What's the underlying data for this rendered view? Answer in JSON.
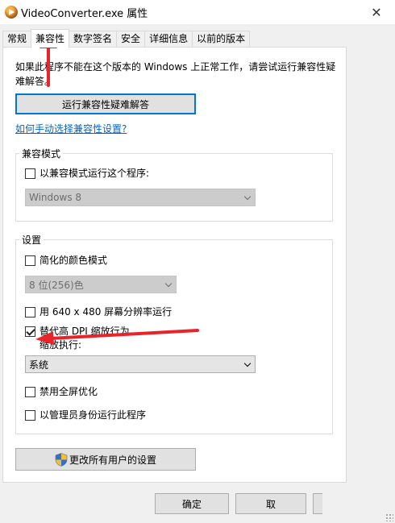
{
  "window": {
    "title": "VideoConverter.exe 属性",
    "close_glyph": "✕"
  },
  "tabs": [
    {
      "label": "常规"
    },
    {
      "label": "兼容性",
      "active": true
    },
    {
      "label": "数字签名"
    },
    {
      "label": "安全"
    },
    {
      "label": "详细信息"
    },
    {
      "label": "以前的版本"
    }
  ],
  "compat": {
    "description": "如果此程序不能在这个版本的 Windows 上正常工作，请尝试运行兼容性疑难解答。",
    "troubleshoot_button": "运行兼容性疑难解答",
    "manual_link": "如何手动选择兼容性设置?"
  },
  "compat_mode": {
    "group_title": "兼容模式",
    "run_in_mode_label": "以兼容模式运行这个程序:",
    "run_in_mode_checked": false,
    "os_select_value": "Windows 8"
  },
  "settings": {
    "group_title": "设置",
    "reduced_color_label": "简化的颜色模式",
    "reduced_color_checked": false,
    "color_select_value": "8 位(256)色",
    "run_640_label": "用 640 x 480 屏幕分辨率运行",
    "run_640_checked": false,
    "dpi_override_label": "替代高 DPI 缩放行为。",
    "dpi_override_sublabel": "缩放执行:",
    "dpi_override_checked": true,
    "dpi_select_value": "系统",
    "disable_fullscreen_label": "禁用全屏优化",
    "disable_fullscreen_checked": false,
    "run_as_admin_label": "以管理员身份运行此程序",
    "run_as_admin_checked": false
  },
  "change_all_users_button": "更改所有用户的设置",
  "footer": {
    "ok_label": "确定",
    "cancel_label": "取"
  },
  "colors": {
    "accent_blue": "#0078d7",
    "link_blue": "#0066cc",
    "annotation_red": "#e8242a"
  }
}
